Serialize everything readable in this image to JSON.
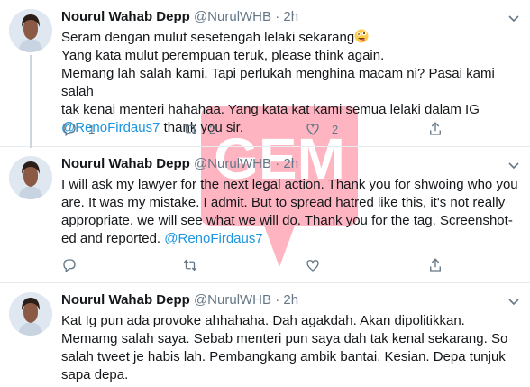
{
  "tweets": [
    {
      "name": "Nourul Wahab Depp",
      "handle": "@NurulWHB",
      "separator": "·",
      "time": "2h",
      "lines": [
        "Seram dengan mulut sesetengah lelaki sekarang",
        "Yang kata mulut perempuan teruk, please think again.",
        "Memang lah salah kami. Tapi perlukah menghina macam ni? Pasai kami salah",
        "tak kenai menteri hahahaa. Yang kata kat kami semua lelaki dalam IG"
      ],
      "mention": "@RenoFirdaus7",
      "after_mention": " thank you sir.",
      "emoji": "zany-face-emoji",
      "reply_count": "1",
      "retweet_count": "2",
      "like_count": "2"
    },
    {
      "name": "Nourul Wahab Depp",
      "handle": "@NurulWHB",
      "separator": "·",
      "time": "2h",
      "lines": [
        "I will ask my lawyer for the next legal action. Thank you for shwoing who you",
        "are. It was my mistake. I admit. But to spread hatred like this, it's not really",
        "appropriate. we will see what we will do. Thank you for the tag. Screenshot-",
        "ed and reported. "
      ],
      "mention": "@RenoFirdaus7",
      "reply_count": "",
      "retweet_count": "",
      "like_count": ""
    },
    {
      "name": "Nourul Wahab Depp",
      "handle": "@NurulWHB",
      "separator": "·",
      "time": "2h",
      "lines": [
        "Kat Ig pun ada provoke ahhahaha. Dah agakdah. Akan dipolitikkan.",
        "Memamg salah saya. Sebab menteri pun saya dah tak kenal sekarang. So",
        "salah tweet je habis lah. Pembangkang ambik bantai. Kesian. Depa tunjuk",
        "sapa depa."
      ]
    }
  ],
  "watermark": {
    "text": "GEM",
    "color": "#ff5a78"
  },
  "colors": {
    "text": "#14171a",
    "secondary": "#657786",
    "link": "#1b95e0",
    "divider": "#e6ecf0"
  },
  "icons": [
    "reply-icon",
    "retweet-icon",
    "like-icon",
    "share-icon",
    "caret-down-icon"
  ]
}
